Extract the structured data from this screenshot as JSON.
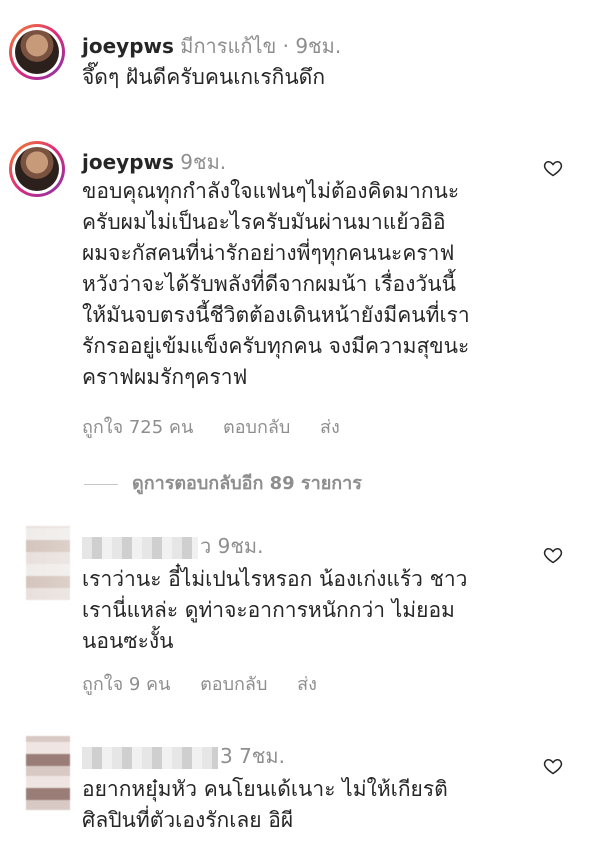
{
  "comment1": {
    "username": "joeypws",
    "meta": " มีการแก้ไข · 9ชม.",
    "text": "จึ๊ดๆ ฝันดีครับคนเกเรกินดึก"
  },
  "comment2": {
    "username": "joeypws",
    "meta": " 9ชม.",
    "lines": [
      "ขอบคุณทุกกำลังใจแฟนๆไม่ต้องคิดมากนะ",
      "ครับผมไม่เป็นอะไรครับมันผ่านมาแย้วอิอิ",
      "ผมจะกัสคนที่น่ารักอย่างพี่ๆทุกคนนะคราฟ",
      "หวังว่าจะได้รับพลังที่ดีจากผมน้า เรื่องวันนี้",
      "ให้มันจบตรงนี้ชีวิตต้องเดินหน้ายังมีคนที่เรา",
      "รักรออยู่เข้มแข็งครับทุกคน  จงมีความสุขนะ",
      "คราฟผมรักๆคราฟ"
    ],
    "likes": "ถูกใจ 725 คน",
    "reply": "ตอบกลับ",
    "send": "ส่ง",
    "view_replies": "ดูการตอบกลับอีก 89 รายการ"
  },
  "comment3": {
    "meta": "ว 9ชม.",
    "lines": [
      "เราว่านะ อี๋ไม่เปนไรหรอก น้องเก่งแร้ว ชาว",
      "เรานี่แหล่ะ ดูท่าจะอาการหนักกว่า  ไม่ยอม",
      "นอนซะงั้น"
    ],
    "likes": "ถูกใจ 9 คน",
    "reply": "ตอบกลับ",
    "send": "ส่ง"
  },
  "comment4": {
    "meta": "3 7ชม.",
    "lines": [
      "อยากหยุ๋มหัว คนโยนเด้เนาะ ไม่ให้เกียรติ",
      "ศิลปินที่ตัวเองรักเลย อิผี"
    ]
  },
  "colors": {
    "text": "#262626",
    "secondary": "#8e8e8e",
    "ring_start": "#f58529",
    "ring_end": "#8134af"
  }
}
